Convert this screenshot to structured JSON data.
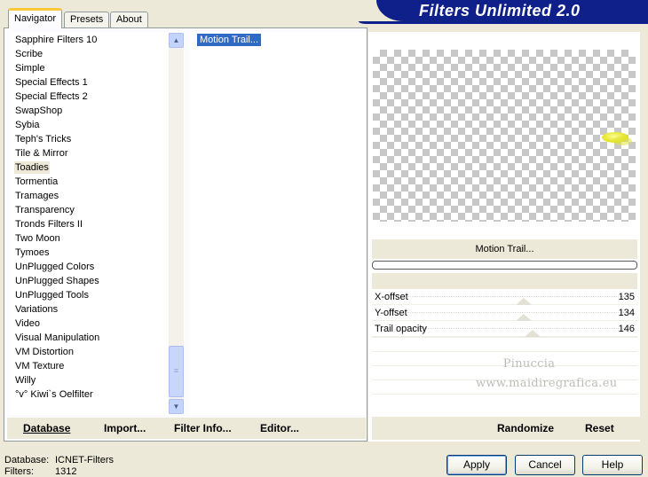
{
  "app": {
    "title": "Filters Unlimited 2.0"
  },
  "tabs": [
    {
      "label": "Navigator",
      "active": true
    },
    {
      "label": "Presets",
      "active": false
    },
    {
      "label": "About",
      "active": false
    }
  ],
  "categories": {
    "items": [
      "Sapphire Filters 10",
      "Scribe",
      "Simple",
      "Special Effects 1",
      "Special Effects 2",
      "SwapShop",
      "Sybia",
      "Teph's Tricks",
      "Tile & Mirror",
      "Toadies",
      "Tormentia",
      "Tramages",
      "Transparency",
      "Tronds Filters II",
      "Two Moon",
      "Tymoes",
      "UnPlugged Colors",
      "UnPlugged Shapes",
      "UnPlugged Tools",
      "Variations",
      "Video",
      "Visual Manipulation",
      "VM Distortion",
      "VM Texture",
      "Willy",
      "°v° Kiwi`s Oelfilter"
    ],
    "selected": "Toadies"
  },
  "filters": {
    "items": [
      "Motion Trail..."
    ],
    "selected": "Motion Trail..."
  },
  "left_toolbar": {
    "database": "Database",
    "import": "Import...",
    "filter_info": "Filter Info...",
    "editor": "Editor..."
  },
  "effect": {
    "name": "Motion Trail...",
    "params": [
      {
        "label": "X-offset",
        "value": "135",
        "level": 0.53
      },
      {
        "label": "Y-offset",
        "value": "134",
        "level": 0.53
      },
      {
        "label": "Trail opacity",
        "value": "146",
        "level": 0.57
      }
    ]
  },
  "watermark": {
    "line1": "Pinuccia",
    "line2": "www.maidiregrafica.eu"
  },
  "right_toolbar": {
    "randomize": "Randomize",
    "reset": "Reset"
  },
  "status": {
    "database_label": "Database:",
    "database_value": "ICNET-Filters",
    "filters_label": "Filters:",
    "filters_value": "1312"
  },
  "buttons": {
    "apply": "Apply",
    "cancel": "Cancel",
    "help": "Help"
  },
  "colors": {
    "banner": "#10208a",
    "selection": "#316ac5",
    "window_bg": "#ece9d8",
    "blob": "#eaea3a"
  }
}
